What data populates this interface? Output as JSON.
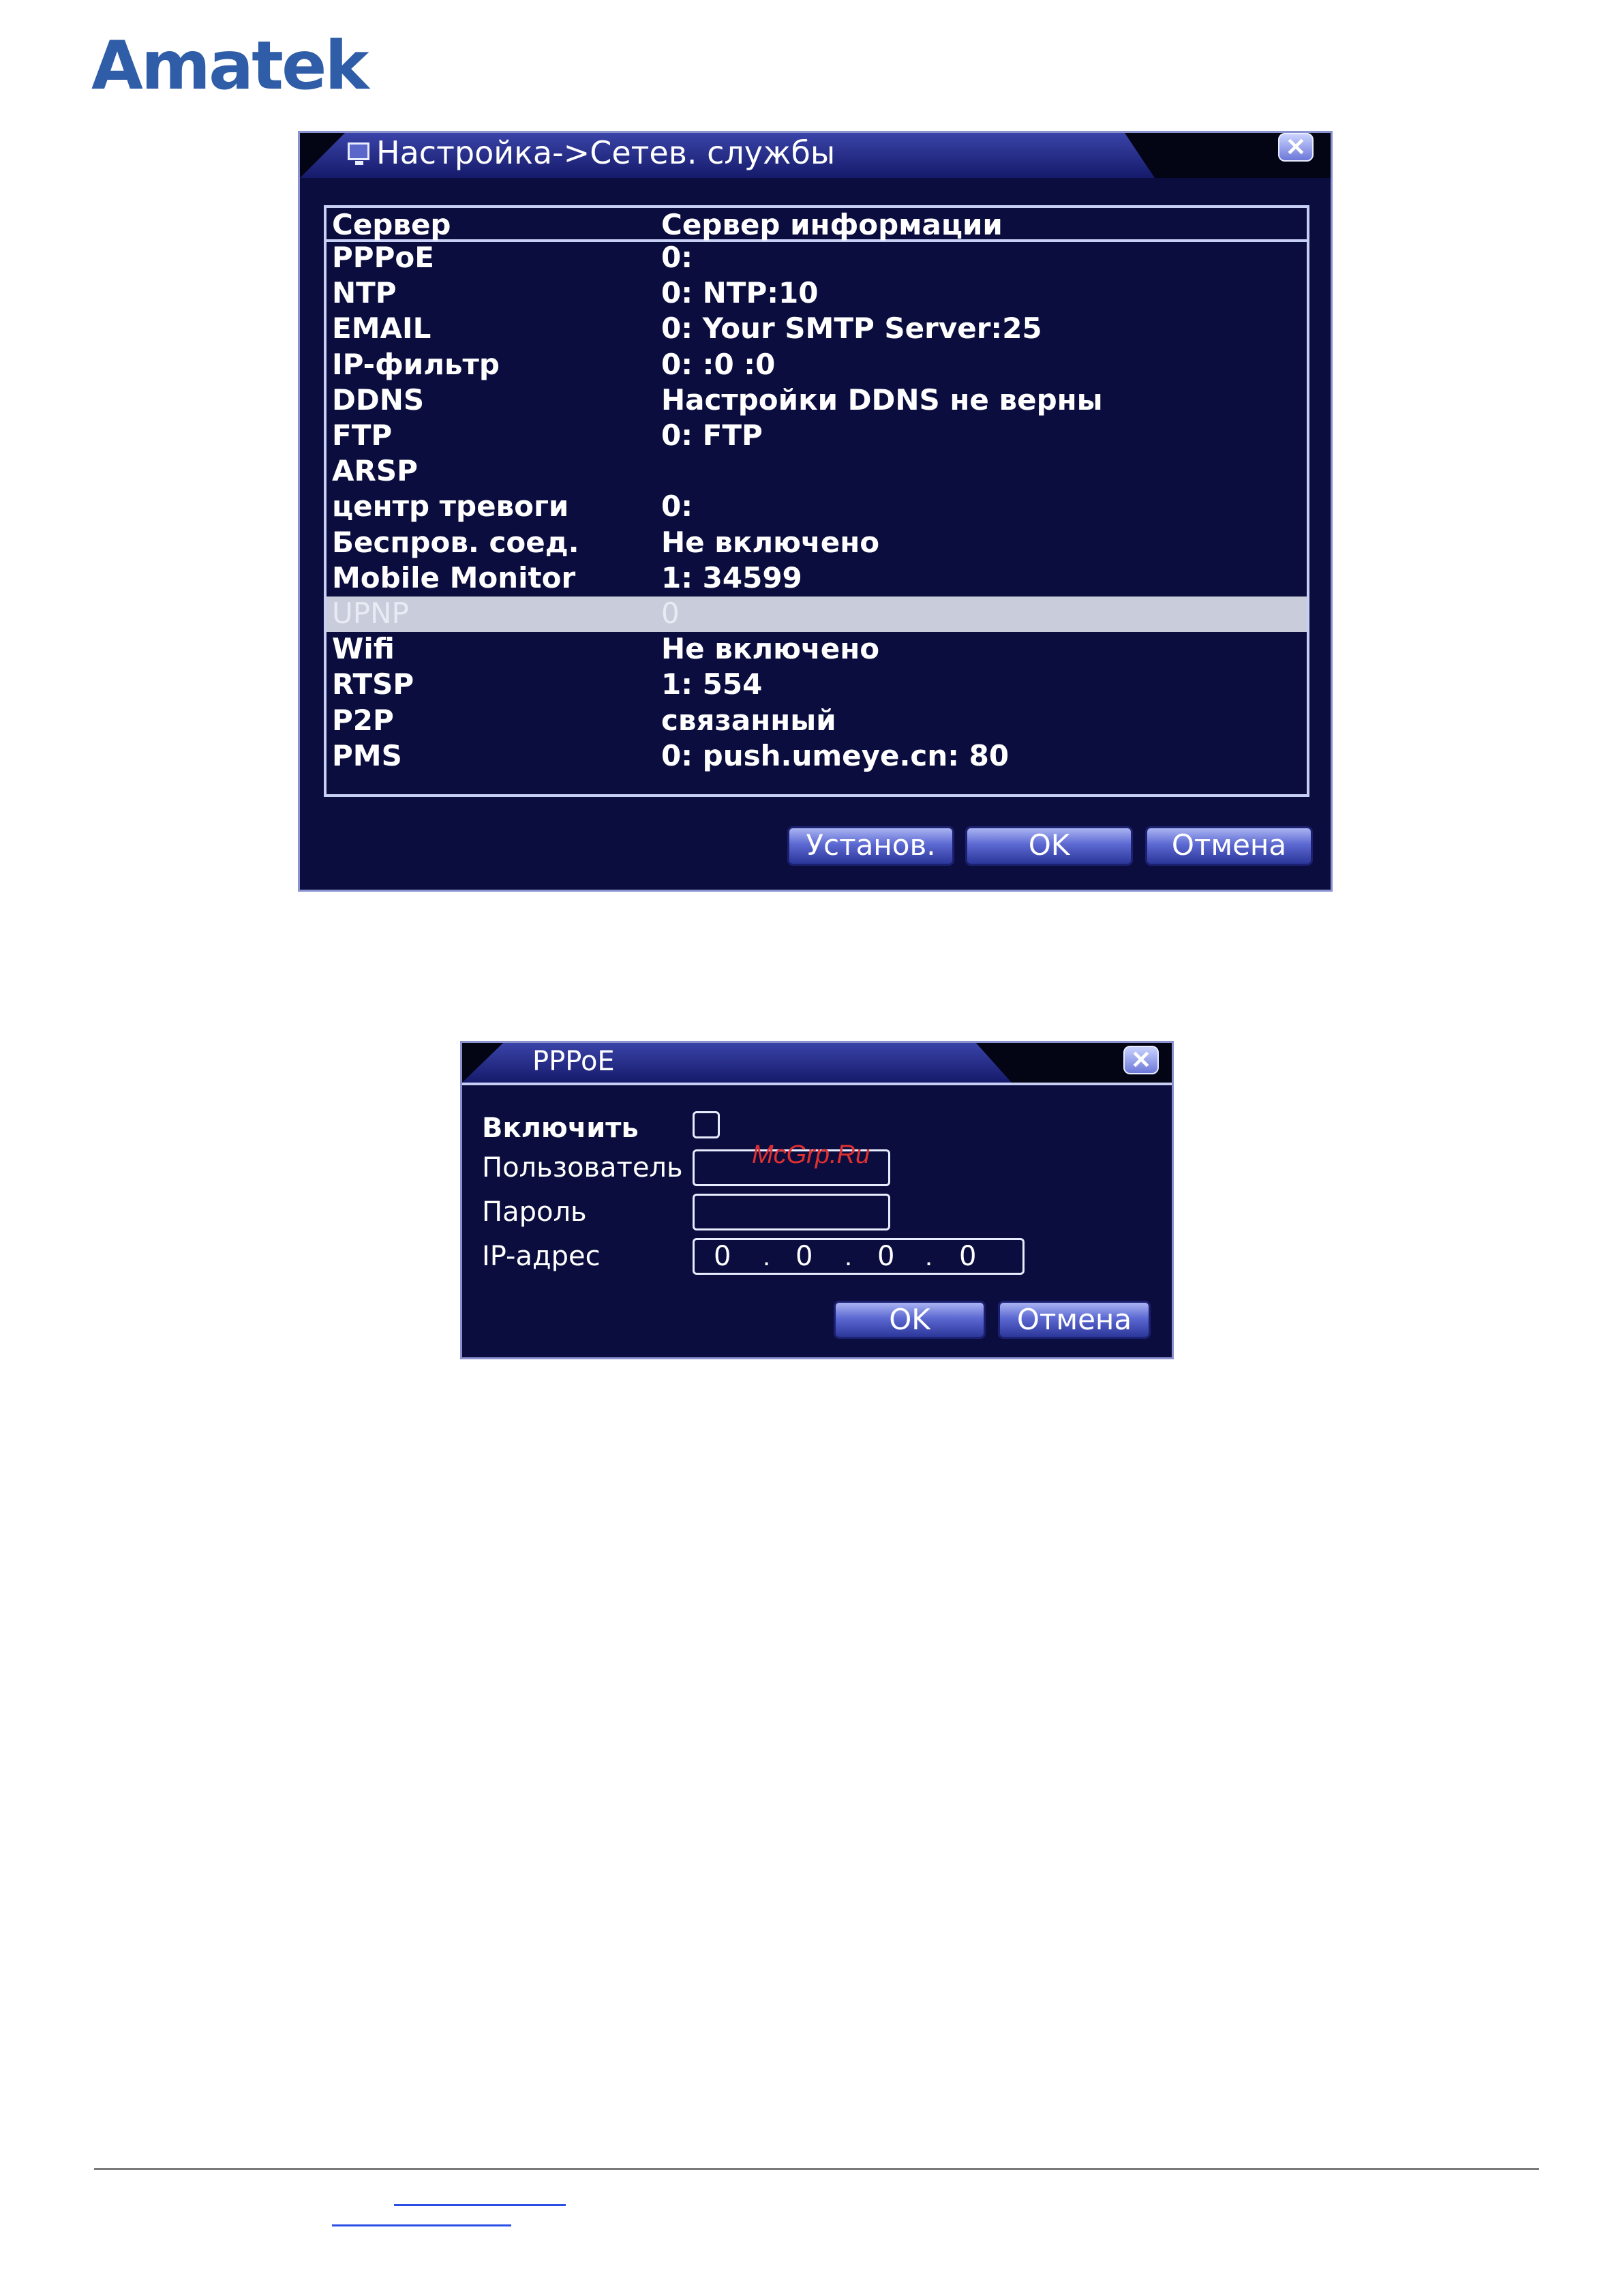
{
  "brand": {
    "logo_text": "Amatek"
  },
  "main_dialog": {
    "title": "Настройка->Сетев. службы",
    "columns": [
      "Сервер",
      "Сервер информации"
    ],
    "rows": [
      {
        "server": "PPPoE",
        "info": "0:"
      },
      {
        "server": "NTP",
        "info": "0: NTP:10"
      },
      {
        "server": "EMAIL",
        "info": "0: Your SMTP Server:25"
      },
      {
        "server": "IP-фильтр",
        "info": "0: :0 :0"
      },
      {
        "server": "DDNS",
        "info": "Настройки DDNS не верны"
      },
      {
        "server": "FTP",
        "info": "0: FTP"
      },
      {
        "server": "ARSP",
        "info": ""
      },
      {
        "server": "центр тревоги",
        "info": "0:"
      },
      {
        "server": "Беспров. соед.",
        "info": "Не включено"
      },
      {
        "server": "Mobile Monitor",
        "info": "1: 34599"
      },
      {
        "server": "UPNP",
        "info": "0",
        "selected": true
      },
      {
        "server": "Wifi",
        "info": "Не включено"
      },
      {
        "server": "RTSP",
        "info": "1: 554"
      },
      {
        "server": "P2P",
        "info": "связанный"
      },
      {
        "server": "PMS",
        "info": "0: push.umeye.cn: 80"
      }
    ],
    "buttons": {
      "setup": "Установ.",
      "ok": "OK",
      "cancel": "Отмена"
    }
  },
  "pppoe_dialog": {
    "title": "PPPoE",
    "enable_label": "Включить",
    "enable_checked": false,
    "user_label": "Пользователь",
    "user_value": "",
    "password_label": "Пароль",
    "password_value": "",
    "ip_label": "IP-адрес",
    "ip": [
      "0",
      "0",
      "0",
      "0"
    ],
    "buttons": {
      "ok": "OK",
      "cancel": "Отмена"
    }
  },
  "watermark": "McGrp.Ru",
  "colors": {
    "dialog_bg": "#0b0d3e",
    "selected_row": "#c8ccdb",
    "logo": "#2f5da7"
  }
}
